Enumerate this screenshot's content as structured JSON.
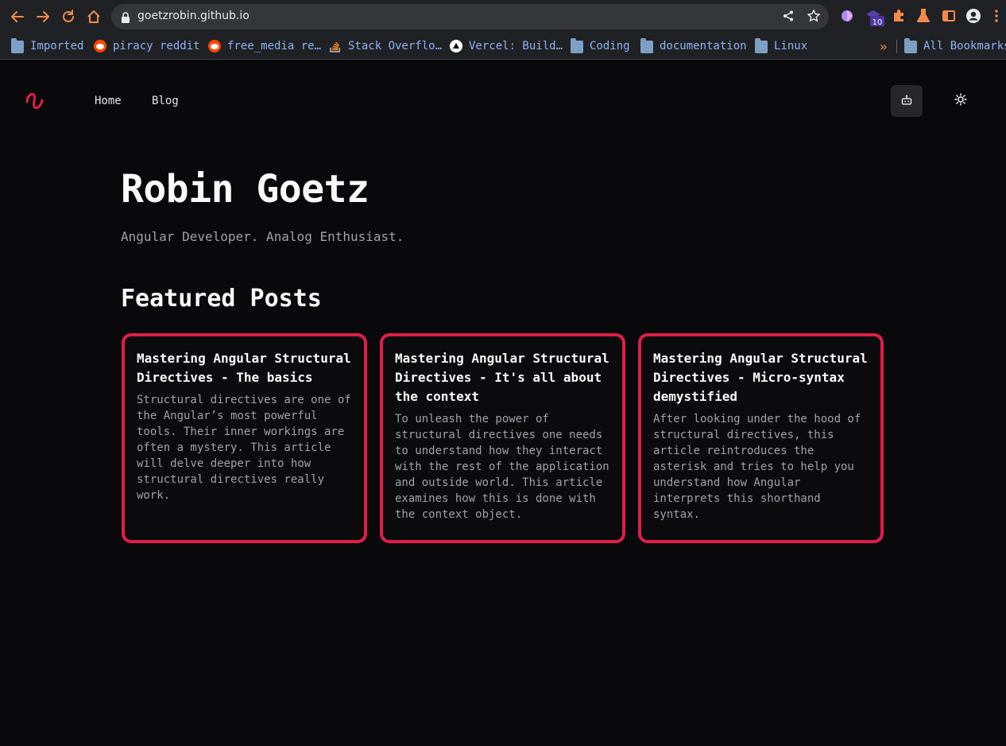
{
  "browser": {
    "url": "goetzrobin.github.io",
    "extension_badge": "10",
    "bookmarks": [
      {
        "label": "Imported",
        "icon": "folder-icon"
      },
      {
        "label": "piracy reddit",
        "icon": "reddit-icon"
      },
      {
        "label": "free_media re…",
        "icon": "reddit-icon"
      },
      {
        "label": "Stack Overflo…",
        "icon": "stackoverflow-icon"
      },
      {
        "label": "Vercel: Build…",
        "icon": "vercel-icon"
      },
      {
        "label": "Coding",
        "icon": "folder-icon"
      },
      {
        "label": "documentation",
        "icon": "folder-icon"
      },
      {
        "label": "Linux",
        "icon": "folder-icon"
      }
    ],
    "overflow_label": "»",
    "all_bookmarks": "All Bookmarks"
  },
  "nav": {
    "home": "Home",
    "blog": "Blog"
  },
  "hero": {
    "title": "Robin Goetz",
    "subtitle": "Angular Developer. Analog Enthusiast."
  },
  "featured": {
    "heading": "Featured Posts",
    "posts": [
      {
        "title": "Mastering Angular Structural Directives - The basics",
        "description": "Structural directives are one of the Angular’s most powerful tools. Their inner workings are often a mystery. This article will delve deeper into how structural directives really work."
      },
      {
        "title": "Mastering Angular Structural Directives - It's all about the context",
        "description": "To unleash the power of structural directives one needs to understand how they interact with the rest of the application and outside world. This article examines how this is done with the context object."
      },
      {
        "title": "Mastering Angular Structural Directives - Micro-syntax demystified",
        "description": "After looking under the hood of structural directives, this article reintroduces the asterisk and tries to help you understand how Angular interprets this shorthand syntax."
      }
    ]
  },
  "colors": {
    "accent": "#e11d48",
    "background": "#09090b",
    "browser_icons": "#f28b49"
  }
}
